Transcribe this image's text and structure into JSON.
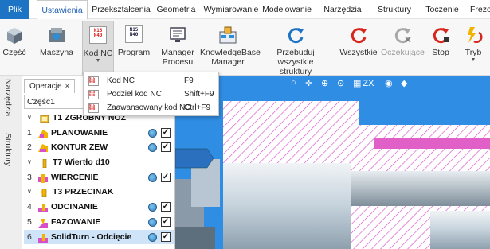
{
  "menubar": {
    "items": [
      "Plik",
      "Ustawienia",
      "Przekształcenia",
      "Geometria",
      "Wymiarowanie",
      "Modelowanie",
      "Narzędzia",
      "Struktury",
      "Toczenie",
      "Frezo"
    ]
  },
  "ribbon": {
    "buttons": [
      {
        "label": "Część",
        "icon": "part-icon"
      },
      {
        "label": "Maszyna",
        "icon": "machine-icon"
      },
      {
        "label": "Kod NC",
        "icon": "nc-code-icon"
      },
      {
        "label": "Program",
        "icon": "program-icon"
      },
      {
        "label": "Manager Procesu",
        "icon": "process-manager-icon"
      },
      {
        "label": "KnowledgeBase Manager",
        "icon": "knowledgebase-icon"
      },
      {
        "label": "Przebuduj wszystkie struktury",
        "icon": "rebuild-icon"
      },
      {
        "label": "Wszystkie",
        "icon": "refresh-all-icon"
      },
      {
        "label": "Oczekujące",
        "icon": "pending-icon"
      },
      {
        "label": "Stop",
        "icon": "stop-icon"
      },
      {
        "label": "Tryb",
        "icon": "mode-icon"
      }
    ],
    "nc_icon_text": "N15\nN40",
    "program_icon_text": "N15\nN40"
  },
  "left_tabs": [
    "Narzędzia",
    "Struktury"
  ],
  "panel": {
    "tab_label": "Operacje",
    "tab_close": "×",
    "combo_value": "Część1",
    "rows": [
      {
        "kind": "tool",
        "caret": "∨",
        "label": "T1  ZGRUBNY NÓŻ",
        "icon": "lathe-tool-icon"
      },
      {
        "kind": "op",
        "num": "1",
        "label": "PLANOWANIE",
        "icon": "facing-icon",
        "checked": true
      },
      {
        "kind": "op",
        "num": "2",
        "label": "KONTUR ZEW",
        "icon": "contour-icon",
        "checked": true
      },
      {
        "kind": "tool",
        "caret": "∨",
        "label": "T7  Wiertło d10",
        "icon": "drill-tool-icon"
      },
      {
        "kind": "op",
        "num": "3",
        "label": "WIERCENIE",
        "icon": "drilling-icon",
        "checked": true
      },
      {
        "kind": "tool",
        "caret": "∨",
        "label": "T3  PRZECINAK",
        "icon": "parting-tool-icon"
      },
      {
        "kind": "op",
        "num": "4",
        "label": "ODCINANIE",
        "icon": "grooving-icon",
        "checked": true
      },
      {
        "kind": "op",
        "num": "5",
        "label": "FAZOWANIE",
        "icon": "chamfer-icon",
        "checked": true
      },
      {
        "kind": "op",
        "num": "6",
        "label": "SolidTurn - Odcięcie",
        "icon": "solidturn-icon",
        "checked": true,
        "selected": true
      }
    ],
    "check_mark": "✓"
  },
  "dropdown": {
    "items": [
      {
        "label": "Kod NC",
        "shortcut": "F9"
      },
      {
        "label": "Podziel kod NC",
        "shortcut": "Shift+F9"
      },
      {
        "label": "Zaawansowany kod NC",
        "shortcut": "Ctrl+F9"
      }
    ],
    "item_icon_text": "N15 N40"
  },
  "view_toolbar": {
    "icons": [
      "orbit-icon",
      "pan-icon",
      "zoom-in-icon",
      "zoom-fit-icon",
      "view-zx-icon",
      "eye-icon",
      "render-icon"
    ],
    "zx_label": "ZX"
  },
  "colors": {
    "accent": "#1e74c4",
    "viewport_bg": "#2f8de4",
    "stock_hatch": "#d94fc9",
    "part_steel": "#b9c9d6",
    "selection": "#cfe4f8"
  }
}
